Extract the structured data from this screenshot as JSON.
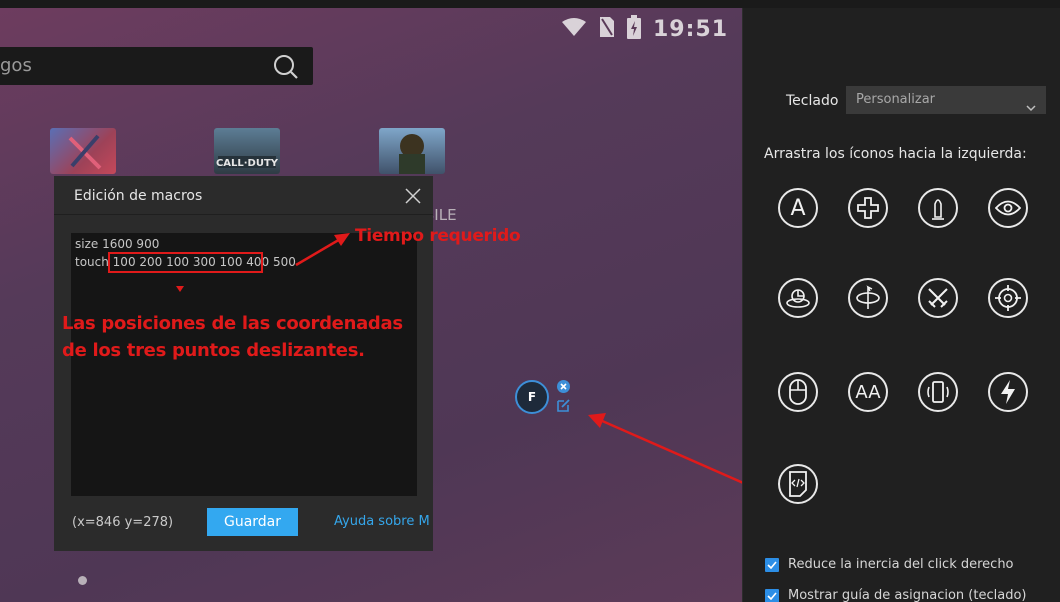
{
  "status_bar": {
    "time": "19:51"
  },
  "home": {
    "search_text": "gos",
    "app_label_partial": "BILE"
  },
  "macro_dialog": {
    "title": "Edición de macros",
    "script_lines": [
      "size 1600 900",
      "touch 100 200 100 300 100 400 500"
    ],
    "coords": "(x=846  y=278)",
    "save_label": "Guardar",
    "help_label": "Ayuda sobre M"
  },
  "annotations": {
    "time_required": "Tiempo requerido",
    "positions_line1": "Las posiciones de las coordenadas",
    "positions_line2": "de los tres puntos deslizantes."
  },
  "key_marker": {
    "label": "F"
  },
  "side_panel": {
    "keyboard_label": "Teclado",
    "keyboard_value": "Personalizar",
    "drag_hint": "Arrastra los íconos hacia la izquierda:",
    "tools": [
      {
        "icon": "letter-a-icon",
        "text": "A"
      },
      {
        "icon": "dpad-icon"
      },
      {
        "icon": "bullet-icon"
      },
      {
        "icon": "eye-icon"
      },
      {
        "icon": "rotate-view-icon"
      },
      {
        "icon": "rotate-icon"
      },
      {
        "icon": "crossed-swords-icon"
      },
      {
        "icon": "crosshair-icon"
      },
      {
        "icon": "mouse-icon"
      },
      {
        "icon": "double-a-icon",
        "text": "AA"
      },
      {
        "icon": "phone-shake-icon"
      },
      {
        "icon": "lightning-icon"
      },
      {
        "icon": "macro-script-icon"
      }
    ],
    "checkboxes": [
      {
        "label": "Reduce la inercia del click derecho",
        "checked": true
      },
      {
        "label": "Mostrar guía de asignacion (teclado)",
        "checked": true
      }
    ]
  },
  "colors": {
    "accent_blue": "#33a8f0",
    "annotation_red": "#e01a1a",
    "panel_bg": "#202020"
  }
}
